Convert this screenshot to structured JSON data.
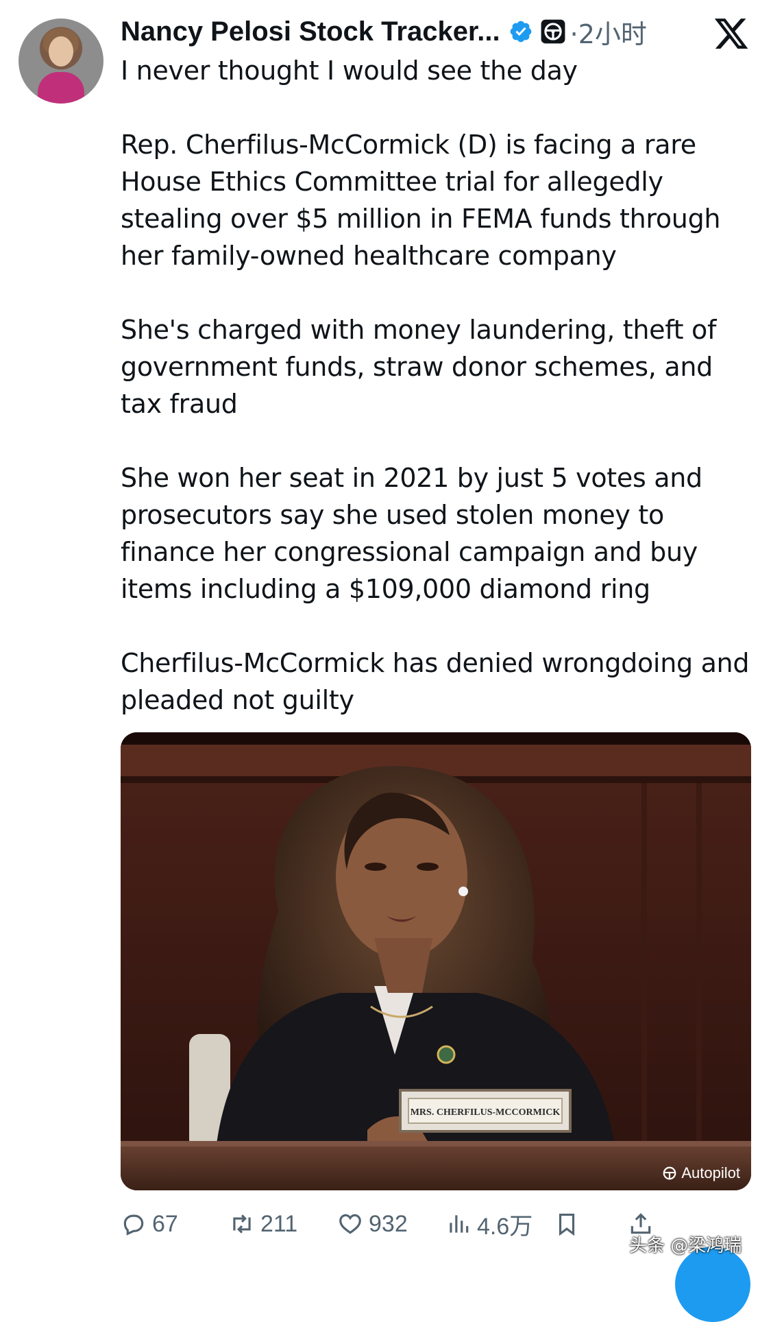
{
  "post": {
    "author_name": "Nancy Pelosi Stock Tracker...",
    "time_label": "·2小时",
    "body": "I never thought I would see the day\n\nRep. Cherfilus-McCormick (D) is facing a rare House Ethics Committee trial for allegedly stealing over $5 million in FEMA funds through her family-owned healthcare company\n\nShe's charged with money laundering, theft of government funds, straw donor schemes, and tax fraud\n\nShe won her seat in 2021 by just 5 votes and prosecutors say she used stolen money to finance her congressional campaign and buy items including a $109,000 diamond ring\n\nCherfilus-McCormick has denied wrongdoing and pleaded not guilty",
    "media": {
      "nameplate_text": "MRS. CHERFILUS-MCCORMICK",
      "badge_label": "Autopilot"
    }
  },
  "actions": {
    "replies": "67",
    "reposts": "211",
    "likes": "932",
    "views": "4.6万"
  },
  "watermark": "头条 @梁鸿瑞",
  "icons": {
    "verified": "verified-badge-icon",
    "steering": "steering-wheel-icon",
    "brand": "x-logo-icon",
    "reply": "reply-icon",
    "repost": "repost-icon",
    "like": "heart-icon",
    "views": "views-chart-icon",
    "bookmark": "bookmark-icon",
    "share": "share-icon"
  },
  "colors": {
    "text": "#0f1419",
    "muted": "#536471",
    "verified": "#1d9bf0",
    "accent": "#1d9bf0"
  }
}
